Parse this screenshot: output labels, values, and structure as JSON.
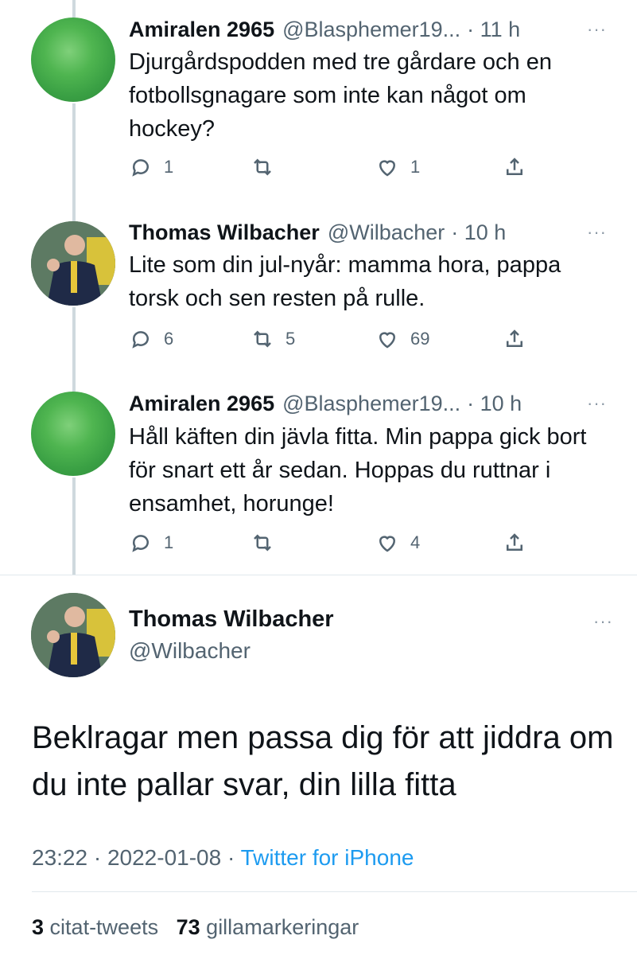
{
  "replies": [
    {
      "name": "Amiralen 2965",
      "handle": "@Blasphemer19...",
      "time": "· 11 h",
      "text": "Djurgårdspodden med tre gårdare och en fotbollsgnagare som inte kan något om hockey?",
      "replies_count": "1",
      "retweets_count": "",
      "likes_count": "1",
      "avatar_color": "#4fb550"
    },
    {
      "name": "Thomas Wilbacher",
      "handle": "@Wilbacher",
      "time": "· 10 h",
      "text": "Lite som din jul-nyår: mamma hora, pappa torsk och sen resten på rulle.",
      "replies_count": "6",
      "retweets_count": "5",
      "likes_count": "69",
      "avatar_color": "#2c3a55"
    },
    {
      "name": "Amiralen 2965",
      "handle": "@Blasphemer19...",
      "time": "· 10 h",
      "text": "Håll käften din jävla fitta. Min pappa gick bort för snart ett år sedan. Hoppas du ruttnar i ensamhet, horunge!",
      "replies_count": "1",
      "retweets_count": "",
      "likes_count": "4",
      "avatar_color": "#4fb550"
    }
  ],
  "main_tweet": {
    "name": "Thomas Wilbacher",
    "handle": "@Wilbacher",
    "text": "Beklragar men passa dig för att jiddra om du inte pallar svar, din lilla fitta",
    "time": "23:22",
    "date": "2022-01-08",
    "separator": "·",
    "source": "Twitter for iPhone",
    "quote_count": "3",
    "quote_label": "citat-tweets",
    "like_count": "73",
    "like_label": "gillamarkeringar"
  },
  "more_icon": "···",
  "icons": {
    "reply": "speech-bubble-icon",
    "retweet": "retweet-icon",
    "like": "heart-icon",
    "share": "share-icon"
  },
  "colors": {
    "text": "#0f1419",
    "secondary": "#536471",
    "link": "#1d9bf0",
    "thread_line": "#cfd9de"
  }
}
